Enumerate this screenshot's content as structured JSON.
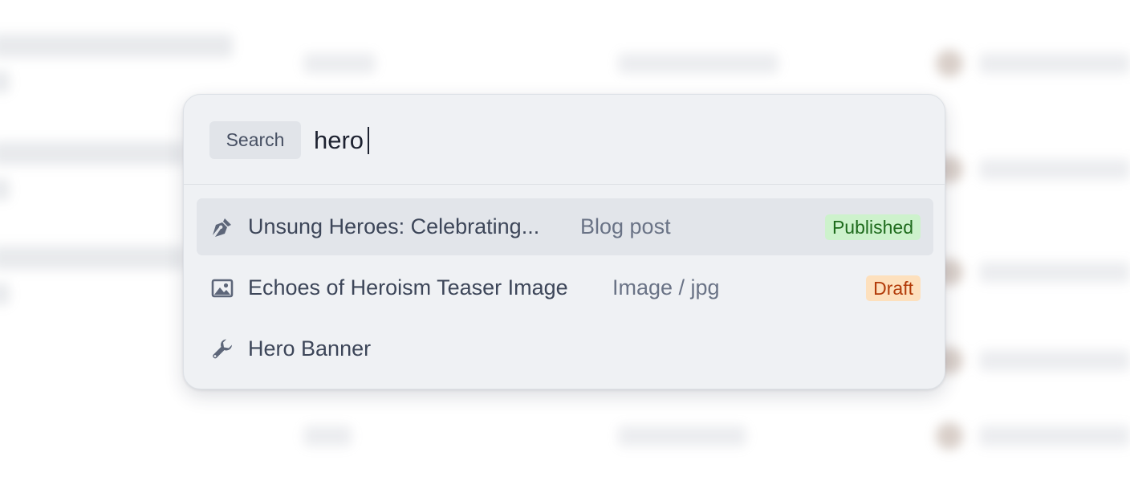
{
  "search": {
    "label": "Search",
    "query": "hero"
  },
  "results": [
    {
      "icon": "pen-icon",
      "title": "Unsung Heroes: Celebrating...",
      "type": "Blog post",
      "status": "Published",
      "status_color": "#1e6b1c",
      "status_bg": "#cdf2cc"
    },
    {
      "icon": "image-icon",
      "title": "Echoes of Heroism Teaser Image",
      "type": "Image / jpg",
      "status": "Draft",
      "status_color": "#b23a08",
      "status_bg": "#fde0bd"
    },
    {
      "icon": "wrench-icon",
      "title": "Hero Banner",
      "type": "",
      "status": ""
    }
  ]
}
